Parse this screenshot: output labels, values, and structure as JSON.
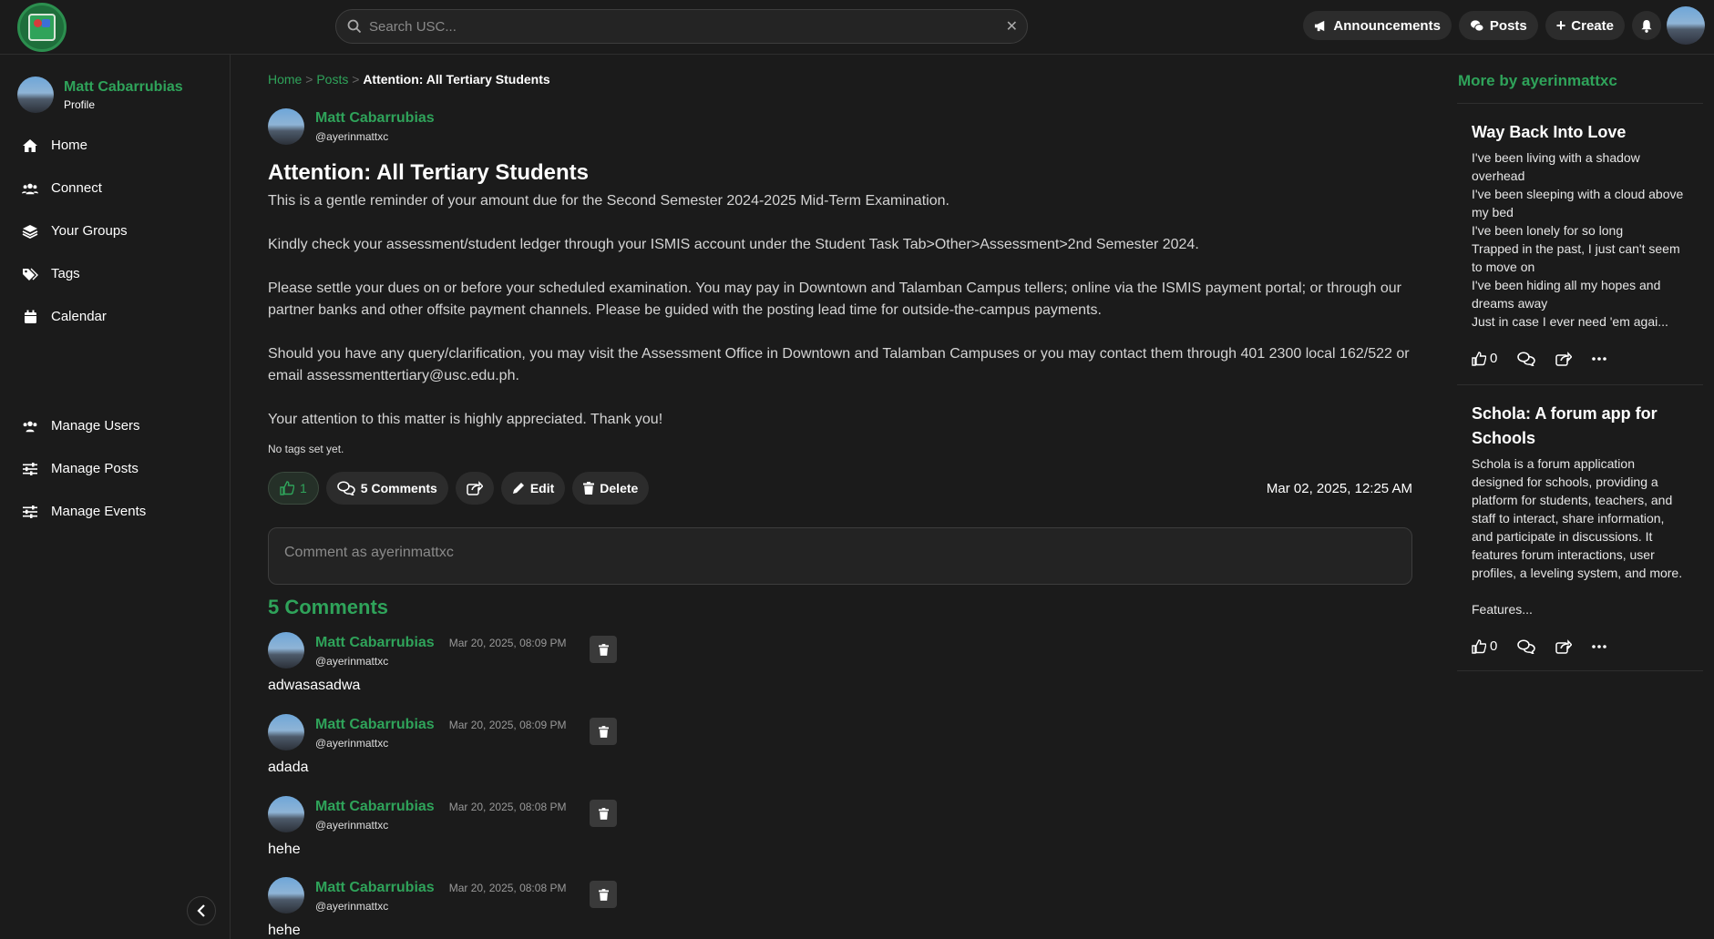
{
  "topbar": {
    "search_placeholder": "Search USC...",
    "nav": [
      {
        "label": "Announcements",
        "icon": "megaphone-icon"
      },
      {
        "label": "Posts",
        "icon": "chat-icon"
      },
      {
        "label": "Create",
        "icon": "plus-icon"
      }
    ]
  },
  "sidebar": {
    "profile_name": "Matt Cabarrubias",
    "profile_sub": "Profile",
    "items": [
      {
        "label": "Home",
        "icon": "home-icon"
      },
      {
        "label": "Connect",
        "icon": "users-icon"
      },
      {
        "label": "Your Groups",
        "icon": "layers-icon"
      },
      {
        "label": "Tags",
        "icon": "tag-icon"
      },
      {
        "label": "Calendar",
        "icon": "calendar-icon"
      }
    ],
    "admin_items": [
      {
        "label": "Manage Users",
        "icon": "users-icon"
      },
      {
        "label": "Manage Posts",
        "icon": "sliders-icon"
      },
      {
        "label": "Manage Events",
        "icon": "sliders-icon"
      }
    ]
  },
  "breadcrumb": {
    "home": "Home",
    "posts": "Posts",
    "sep": ">",
    "current": "Attention: All Tertiary Students"
  },
  "post": {
    "author_name": "Matt Cabarrubias",
    "author_handle": "@ayerinmattxc",
    "title": "Attention: All Tertiary Students",
    "paragraphs": [
      "This is a gentle reminder of your amount due for the Second Semester 2024-2025 Mid-Term Examination.",
      "Kindly check your assessment/student ledger through your ISMIS account under the Student Task Tab>Other>Assessment>2nd Semester 2024.",
      "Please settle your dues on or before your scheduled examination. You may pay in Downtown and Talamban Campus tellers; online via the ISMIS payment portal; or through our partner banks and other offsite payment channels. Please be guided with the posting lead time for outside-the-campus payments.",
      "Should you have any query/clarification, you may visit the Assessment Office in Downtown and Talamban Campuses or you may contact them through 401 2300 local 162/522 or email assessmenttertiary@usc.edu.ph.",
      "Your attention to this matter is highly appreciated. Thank you!"
    ],
    "tags_text": "No tags set yet.",
    "like_count": "1",
    "comments_label": "5 Comments",
    "edit_label": "Edit",
    "delete_label": "Delete",
    "date": "Mar 02, 2025, 12:25 AM",
    "comment_placeholder": "Comment as ayerinmattxc"
  },
  "comments": {
    "heading": "5 Comments",
    "items": [
      {
        "name": "Matt Cabarrubias",
        "handle": "@ayerinmattxc",
        "date": "Mar 20, 2025, 08:09 PM",
        "text": "adwasasadwa"
      },
      {
        "name": "Matt Cabarrubias",
        "handle": "@ayerinmattxc",
        "date": "Mar 20, 2025, 08:09 PM",
        "text": "adada"
      },
      {
        "name": "Matt Cabarrubias",
        "handle": "@ayerinmattxc",
        "date": "Mar 20, 2025, 08:08 PM",
        "text": "hehe"
      },
      {
        "name": "Matt Cabarrubias",
        "handle": "@ayerinmattxc",
        "date": "Mar 20, 2025, 08:08 PM",
        "text": "hehe"
      }
    ]
  },
  "more": {
    "heading": "More by ayerinmattxc",
    "cards": [
      {
        "title": "Way Back Into Love",
        "lines": [
          "I've been living with a shadow overhead",
          "I've been sleeping with a cloud above my bed",
          "I've been lonely for so long",
          "Trapped in the past, I just can't seem to move on",
          "I've been hiding all my hopes and dreams away",
          "Just in case I ever need 'em agai..."
        ],
        "likes": "0"
      },
      {
        "title": "Schola: A forum app for Schools",
        "lines": [
          "Schola is a forum application designed for schools, providing a platform for students, teachers, and staff to interact, share information, and participate in discussions. It features forum interactions, user profiles, a leveling system, and more.",
          "",
          "Features..."
        ],
        "likes": "0"
      }
    ]
  },
  "colors": {
    "accent": "#2fa35a",
    "background": "#1b1b1b"
  }
}
